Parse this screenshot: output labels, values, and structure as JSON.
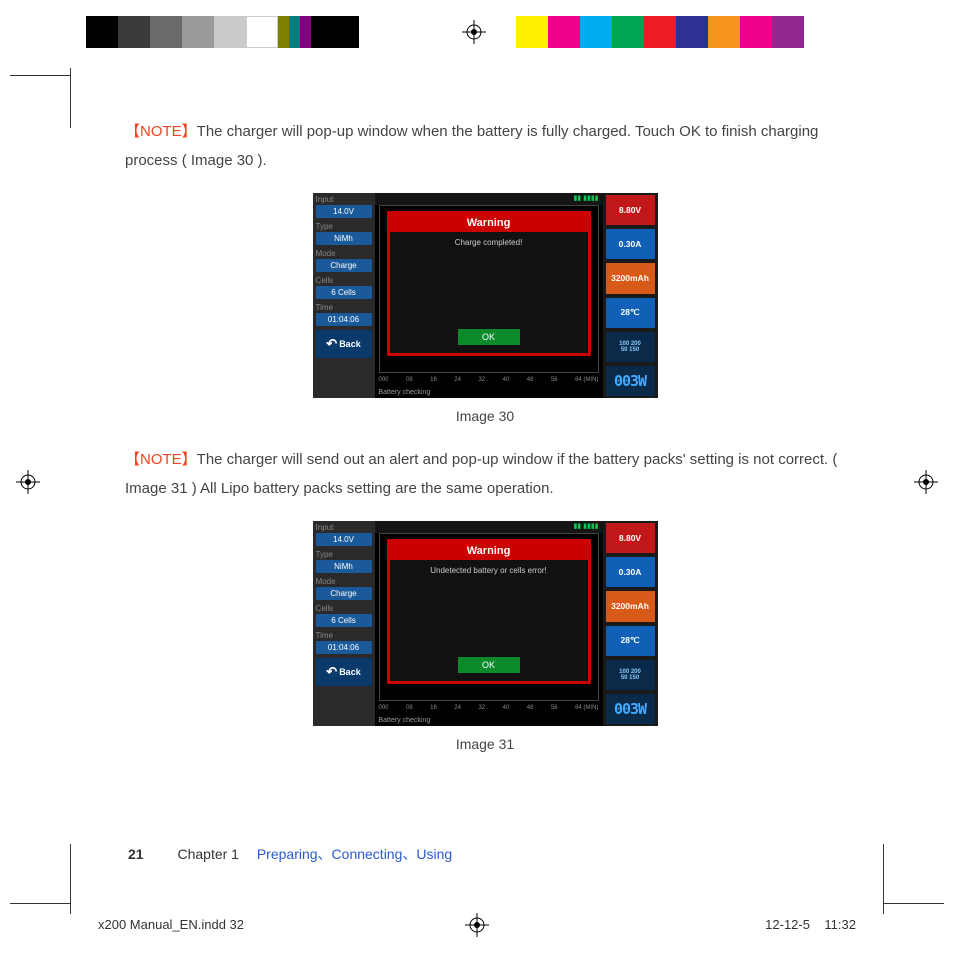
{
  "top_colors_a": [
    "#000",
    "#3a3a3a",
    "#6a6a6a",
    "#9a9a9a",
    "#cacaca",
    "#fff"
  ],
  "top_colors_b": [
    "#fff200",
    "#ec008c",
    "#00aeef",
    "#00a651",
    "#ed1c24",
    "#2e3192",
    "#f7941d",
    "#ec008c",
    "#92278f"
  ],
  "note_label": "【NOTE】",
  "note1_text": "The charger will pop-up window when the battery is fully charged. Touch OK to finish charging process ( Image 30 ).",
  "fig30_caption": "Image 30",
  "note2_text": "The charger will send out an alert and pop-up window if the battery packs' setting is not correct. ( Image 31 ) All Lipo battery packs setting are the same operation.",
  "fig31_caption": "Image 31",
  "charger_left": {
    "input_lbl": "Input",
    "input_val": "14.0V",
    "type_lbl": "Type",
    "type_val": "NiMh",
    "mode_lbl": "Mode",
    "mode_val": "Charge",
    "cells_lbl": "Cells",
    "cells_val": "6 Cells",
    "time_lbl": "Time",
    "time_val": "01:04:06",
    "back": "Back"
  },
  "charger_right": {
    "voltage": "8.80V",
    "current": "0.30A",
    "capacity": "3200mAh",
    "temp": "28℃",
    "gauge": "100 200\n50 150",
    "logo": "003W"
  },
  "charger_popup": {
    "title": "Warning",
    "msg30": "Charge completed!",
    "msg31": "Undetected battery or cells error!",
    "ok": "OK"
  },
  "charger_status": "Battery checking",
  "charger_xaxis": [
    "000",
    "08",
    "16",
    "24",
    "32",
    "40",
    "48",
    "56",
    "64 (MIN)"
  ],
  "footer": {
    "page": "21",
    "chapter": "Chapter 1",
    "section": "Preparing、Connecting、Using"
  },
  "bottom": {
    "file": "x200 Manual_EN.indd   32",
    "date": "12-12-5",
    "time": "11:32"
  }
}
